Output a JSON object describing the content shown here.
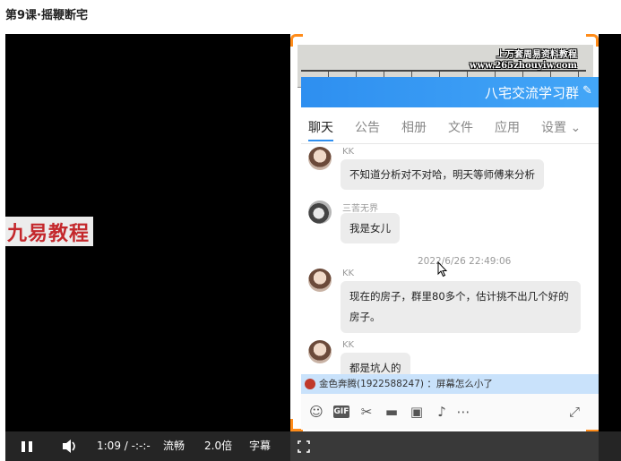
{
  "page": {
    "title": "第9课·摇鞭断宅"
  },
  "video": {
    "watermark_left": "九易教程"
  },
  "chat": {
    "watermark": {
      "line1": "上万套周易资料教程",
      "line2": "www.265zhouyiw.com"
    },
    "group_name": "八宅交流学习群",
    "tabs": [
      {
        "label": "聊天"
      },
      {
        "label": "公告"
      },
      {
        "label": "相册"
      },
      {
        "label": "文件"
      },
      {
        "label": "应用"
      },
      {
        "label": "设置 ⌄"
      }
    ],
    "messages": [
      {
        "sender": "KK",
        "text": "不知道分析对不对哈，明天等师傅来分析"
      },
      {
        "sender": "三苦无界",
        "text": "我是女儿"
      },
      {
        "sender": "KK",
        "text": "现在的房子，群里80多个，估计挑不出几个好的房子。"
      },
      {
        "sender": "KK",
        "text": "都是坑人的"
      }
    ],
    "timestamp": "2022/6/26 22:49:06",
    "danmaku": "金色奔腾(1922588247) ：屏幕怎么小了",
    "toolbar_icons": [
      "emoji-icon",
      "gif-icon",
      "scissors-icon",
      "folder-icon",
      "image-icon",
      "bell-icon",
      "more-icon",
      "expand-icon"
    ]
  },
  "controls": {
    "time": "1:09 / -:-:-",
    "quality": "流畅",
    "speed": "2.0倍",
    "subtitle": "字幕"
  },
  "colors": {
    "accent": "#2e8ff0",
    "orange_frame": "#ff8c1a",
    "watermark_red": "#c4282c"
  }
}
